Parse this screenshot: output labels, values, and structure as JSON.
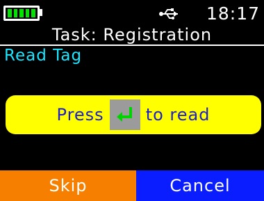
{
  "status_bar": {
    "battery_level": 1.0,
    "battery_icon": "battery-icon",
    "usb_icon": "usb-icon",
    "time": "18:17"
  },
  "header": {
    "title": "Task: Registration"
  },
  "section": {
    "title": "Read Tag"
  },
  "prompt": {
    "before": "Press",
    "key_icon": "enter-key-icon",
    "after": "to read"
  },
  "softkeys": {
    "left": "Skip",
    "right": "Cancel"
  },
  "colors": {
    "background": "#000000",
    "section_title": "#19e6ff",
    "prompt_panel": "#ffff00",
    "prompt_text": "#1d1fc8",
    "enter_icon": "#00d400",
    "softkey_left": "#f77f00",
    "softkey_right": "#0a1dff",
    "battery_fill": "#00e400"
  }
}
